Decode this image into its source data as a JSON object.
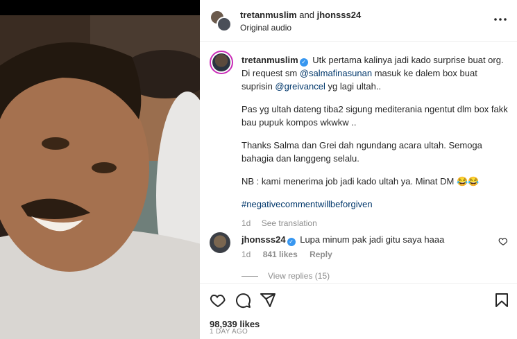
{
  "post": {
    "header": {
      "user1": "tretanmuslim",
      "and_text": "and",
      "user2": "jhonsss24",
      "audio": "Original audio",
      "more_icon": "more-horizontal-icon"
    },
    "caption": {
      "username": "tretanmuslim",
      "line1": "Utk pertama kalinya jadi kado surprise buat org.",
      "line2_pre": "Di request sm ",
      "mention1": "@salmafinasunan",
      "line2_post": " masuk ke dalem box buat",
      "line3_pre": "suprisin ",
      "mention2": "@greivancel",
      "line3_post": " yg lagi ultah..",
      "para2": "Pas yg ultah dateng tiba2 sigung mediterania ngentut dlm box fakk bau pupuk kompos wkwkw ..",
      "para3": "Thanks Salma dan Grei dah ngundang acara ultah. Semoga bahagia dan langgeng selalu.",
      "para4": "NB : kami menerima job jadi kado ultah ya. Minat DM 😂😂",
      "hashtag": "#negativecommentwillbeforgiven",
      "time": "1d",
      "see_translation": "See translation"
    },
    "comment": {
      "username": "jhonsss24",
      "text": "Lupa minum pak jadi gitu saya haaa",
      "time": "1d",
      "likes": "841 likes",
      "reply": "Reply",
      "view_replies": "View replies (15)"
    },
    "likes": "98,939 likes",
    "date": "1 DAY AGO"
  },
  "colors": {
    "link": "#00376b",
    "verified": "#3897f0",
    "muted": "#8e8e8e",
    "text": "#262626"
  }
}
